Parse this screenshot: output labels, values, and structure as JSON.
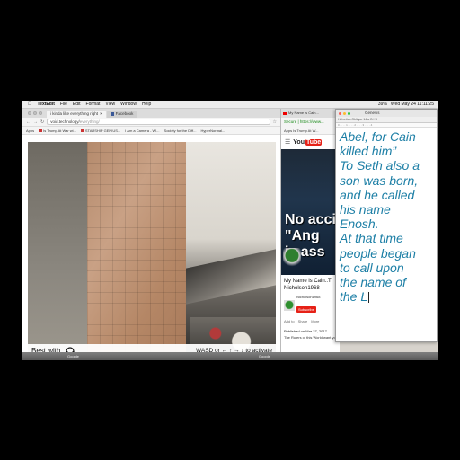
{
  "menubar": {
    "app": "TextEdit",
    "items": [
      "File",
      "Edit",
      "Format",
      "View",
      "Window",
      "Help"
    ],
    "status": [
      "39%",
      "Wed May 24  11:11:25"
    ]
  },
  "browser": {
    "tabs": [
      "i kinda like everything right",
      "Facebook"
    ],
    "url_host": "void.technology/",
    "url_path": "everything/",
    "bookmarks": [
      "Apps",
      "Is Trump At War wi...",
      "STARSHIP GENIUS...",
      "I Am a Camera - Wi...",
      "Society for the Diff...",
      "HyperNormal..."
    ]
  },
  "video_overlay": {
    "best_with": "Best with",
    "controls": "WASD or ← ↑ → ↓ to activate"
  },
  "youtube": {
    "tab": "My Name is Cain...",
    "addr": "Secure | https://www...",
    "bookmarks": "Apps  Is Trump At W...",
    "logo_you": "You",
    "logo_tube": "Tube",
    "video_text": "No acci\n\"Ang\nis ass",
    "title": "My Name is Cain..T",
    "channel": "Nicholson1968",
    "channel_small": "Nicholson1968",
    "subscribe": "Subscribe",
    "actions": [
      "Add to",
      "Share",
      "More"
    ],
    "published": "Published on Mar 27, 2017",
    "description": "The Rulers of this World want you to believe the"
  },
  "textedit": {
    "title": "Genesis",
    "toolbar": "Helvetica  Oblique  14  a  B I U",
    "ruler": "0 . . . . 1 . . . . 2 . . . . 3 . . . . 4",
    "body": "Abel, for Cain\nkilled him”\nTo Seth also a\nson was born,\nand he called\nhis name\nEnosh.\nAt that time\npeople began\nto call upon\nthe name of\nthe L"
  },
  "dock": [
    "Google",
    "Google"
  ]
}
